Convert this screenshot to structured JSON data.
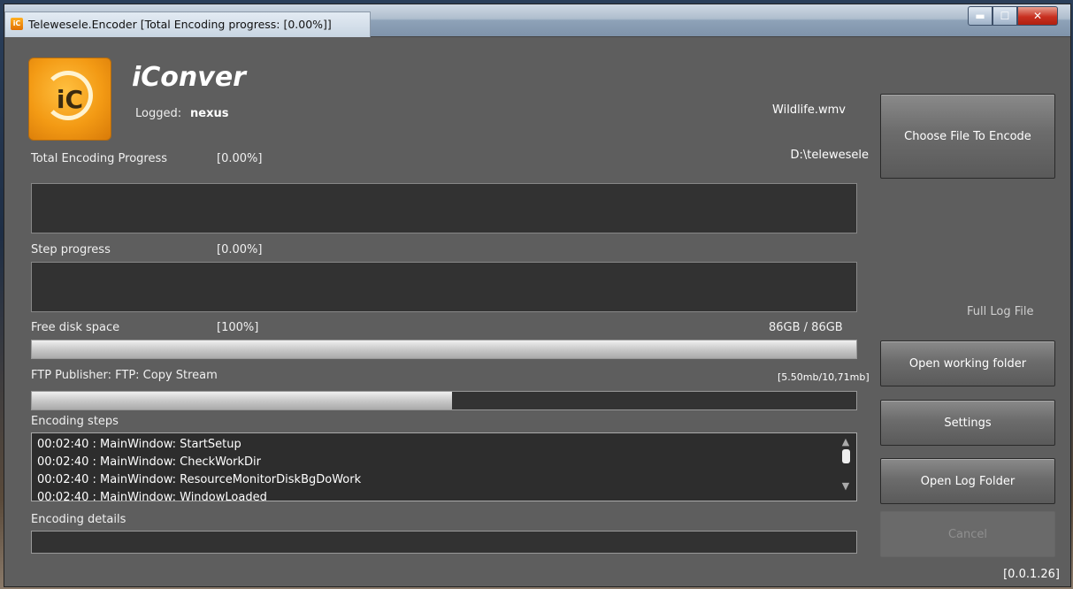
{
  "window": {
    "title": "Telewesele.Encoder [Total Encoding progress: [0.00%]]",
    "icon_text": "iC"
  },
  "app": {
    "logo_text": "iC",
    "name": "iConver",
    "logged_label": "Logged:",
    "logged_user": "nexus"
  },
  "file": {
    "name": "Wildlife.wmv",
    "dir": "D:\\telewesele"
  },
  "total_progress": {
    "label": "Total Encoding Progress",
    "value": "[0.00%]"
  },
  "step_progress": {
    "label": "Step progress",
    "value": "[0.00%]"
  },
  "disk": {
    "label": "Free disk space",
    "value": "[100%]",
    "size": "86GB / 86GB",
    "fraction": 1.0
  },
  "ftp": {
    "label": "FTP Publisher: FTP: Copy Stream",
    "size": "[5.50mb/10,71mb]",
    "fraction": 0.51
  },
  "encoding_steps": {
    "label": "Encoding steps",
    "lines": [
      "00:02:40 : MainWindow: StartSetup",
      "00:02:40 : MainWindow: CheckWorkDir",
      "00:02:40 : MainWindow: ResourceMonitorDiskBgDoWork",
      "00:02:40 : MainWindow: WindowLoaded"
    ]
  },
  "encoding_details": {
    "label": "Encoding details"
  },
  "buttons": {
    "choose_file": "Choose File To Encode",
    "full_log": "Full Log File",
    "open_working": "Open working folder",
    "settings": "Settings",
    "open_log": "Open Log Folder",
    "cancel": "Cancel"
  },
  "version": "[0.0.1.26]"
}
